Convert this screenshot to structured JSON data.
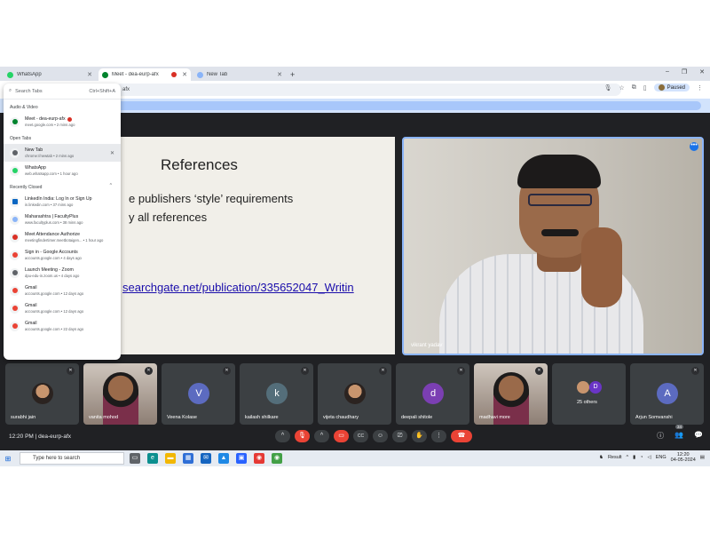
{
  "browser": {
    "tabs": [
      {
        "label": "WhatsApp",
        "color": "#25d366",
        "active": false,
        "recording": false
      },
      {
        "label": "Meet - dea-eurp-afx",
        "color": "#00832d",
        "active": true,
        "recording": true
      },
      {
        "label": "New Tab",
        "color": "#5f6368",
        "active": false,
        "recording": false
      }
    ],
    "new_tab_symbol": "+",
    "window_controls": [
      "–",
      "❐",
      "✕"
    ],
    "address_fragment": "afx",
    "profile_label": "Paused"
  },
  "tab_search": {
    "placeholder": "Search Tabs",
    "shortcut": "Ctrl+Shift+A",
    "sections": [
      {
        "title": "Audio & Video",
        "items": [
          {
            "title": "Meet - dea-eurp-afx",
            "sub": "meet.google.com • 2 mins ago",
            "icon": "meet-icon",
            "color": "#00832d",
            "recording": true
          }
        ]
      },
      {
        "title": "Open Tabs",
        "items": [
          {
            "title": "New Tab",
            "sub": "chrome://newtab • 2 mins ago",
            "icon": "chrome-icon",
            "color": "#5f6368",
            "highlight": true,
            "closable": true
          },
          {
            "title": "WhatsApp",
            "sub": "web.whatsapp.com • 1 hour ago",
            "icon": "whatsapp-icon",
            "color": "#25d366"
          }
        ]
      },
      {
        "title": "Recently Closed",
        "caret": "^",
        "items": [
          {
            "title": "LinkedIn India: Log In or Sign Up",
            "sub": "in.linkedin.com • 37 mins ago",
            "icon": "linkedin-icon",
            "color": "#0a66c2"
          },
          {
            "title": "Maharashtra | FacultyPlus",
            "sub": "www.facultyplus.com • 38 mins ago",
            "icon": "globe-icon",
            "color": "#8ab4f8"
          },
          {
            "title": "Meet Attendance Authorize",
            "sub": "meetingfindertimer.meetbotaigen... • 1 hour ago",
            "icon": "meet-attendance-icon",
            "color": "#d93025"
          },
          {
            "title": "Sign in - Google Accounts",
            "sub": "accounts.google.com • 4 days ago",
            "icon": "google-icon",
            "color": "#ea4335"
          },
          {
            "title": "Launch Meeting - Zoom",
            "sub": "dpu-edu-in.zoom.us • 4 days ago",
            "icon": "zoom-icon",
            "color": "#5f6368"
          },
          {
            "title": "Gmail",
            "sub": "accounts.google.com • 12 days ago",
            "icon": "google-icon",
            "color": "#ea4335"
          },
          {
            "title": "Gmail",
            "sub": "accounts.google.com • 12 days ago",
            "icon": "google-icon",
            "color": "#ea4335"
          },
          {
            "title": "Gmail",
            "sub": "accounts.google.com • 22 days ago",
            "icon": "google-icon",
            "color": "#ea4335"
          }
        ]
      }
    ]
  },
  "slide": {
    "title": "References",
    "line1": "e publishers ‘style’ requirements",
    "line2": "y all references",
    "link": "searchgate.net/publication/335652047_Writin"
  },
  "speaker": {
    "name": "vikrant yadav",
    "more": "•••"
  },
  "participants": [
    {
      "name": "surabhi jain",
      "type": "photo"
    },
    {
      "name": "vanita mohod",
      "type": "video"
    },
    {
      "name": "Veena Kolase",
      "type": "avatar",
      "initial": "V",
      "color": "#5c6bc0"
    },
    {
      "name": "kailash shilkare",
      "type": "avatar",
      "initial": "k",
      "color": "#546e7a"
    },
    {
      "name": "vijeta chaudhary",
      "type": "photo"
    },
    {
      "name": "deepali shitole",
      "type": "avatar",
      "initial": "d",
      "color": "#7b3fb3"
    },
    {
      "name": "madhavi more",
      "type": "video"
    },
    {
      "name": "25 others",
      "type": "others",
      "initial": "D",
      "color": "#6a35c6"
    },
    {
      "name": "Arjun Somvanshi",
      "type": "avatar",
      "initial": "A",
      "color": "#5c6bc0"
    }
  ],
  "meeting": {
    "time": "12:20 PM",
    "separator": "|",
    "code": "dea-eurp-afx",
    "people_count": "34"
  },
  "controls": [
    {
      "name": "mic-button",
      "symbol": "🎙",
      "red": true
    },
    {
      "name": "camera-button",
      "symbol": "▭",
      "red": true
    },
    {
      "name": "captions-button",
      "symbol": "CC",
      "red": false
    },
    {
      "name": "emoji-button",
      "symbol": "☺",
      "red": false
    },
    {
      "name": "present-button",
      "symbol": "⎚",
      "red": false
    },
    {
      "name": "raise-hand-button",
      "symbol": "✋",
      "red": false
    },
    {
      "name": "more-options-button",
      "symbol": "⋮",
      "red": false
    }
  ],
  "taskbar": {
    "search_placeholder": "Type here to search",
    "result_label": "Result",
    "lang": "ENG",
    "time": "12:20",
    "date": "04-05-2024"
  }
}
